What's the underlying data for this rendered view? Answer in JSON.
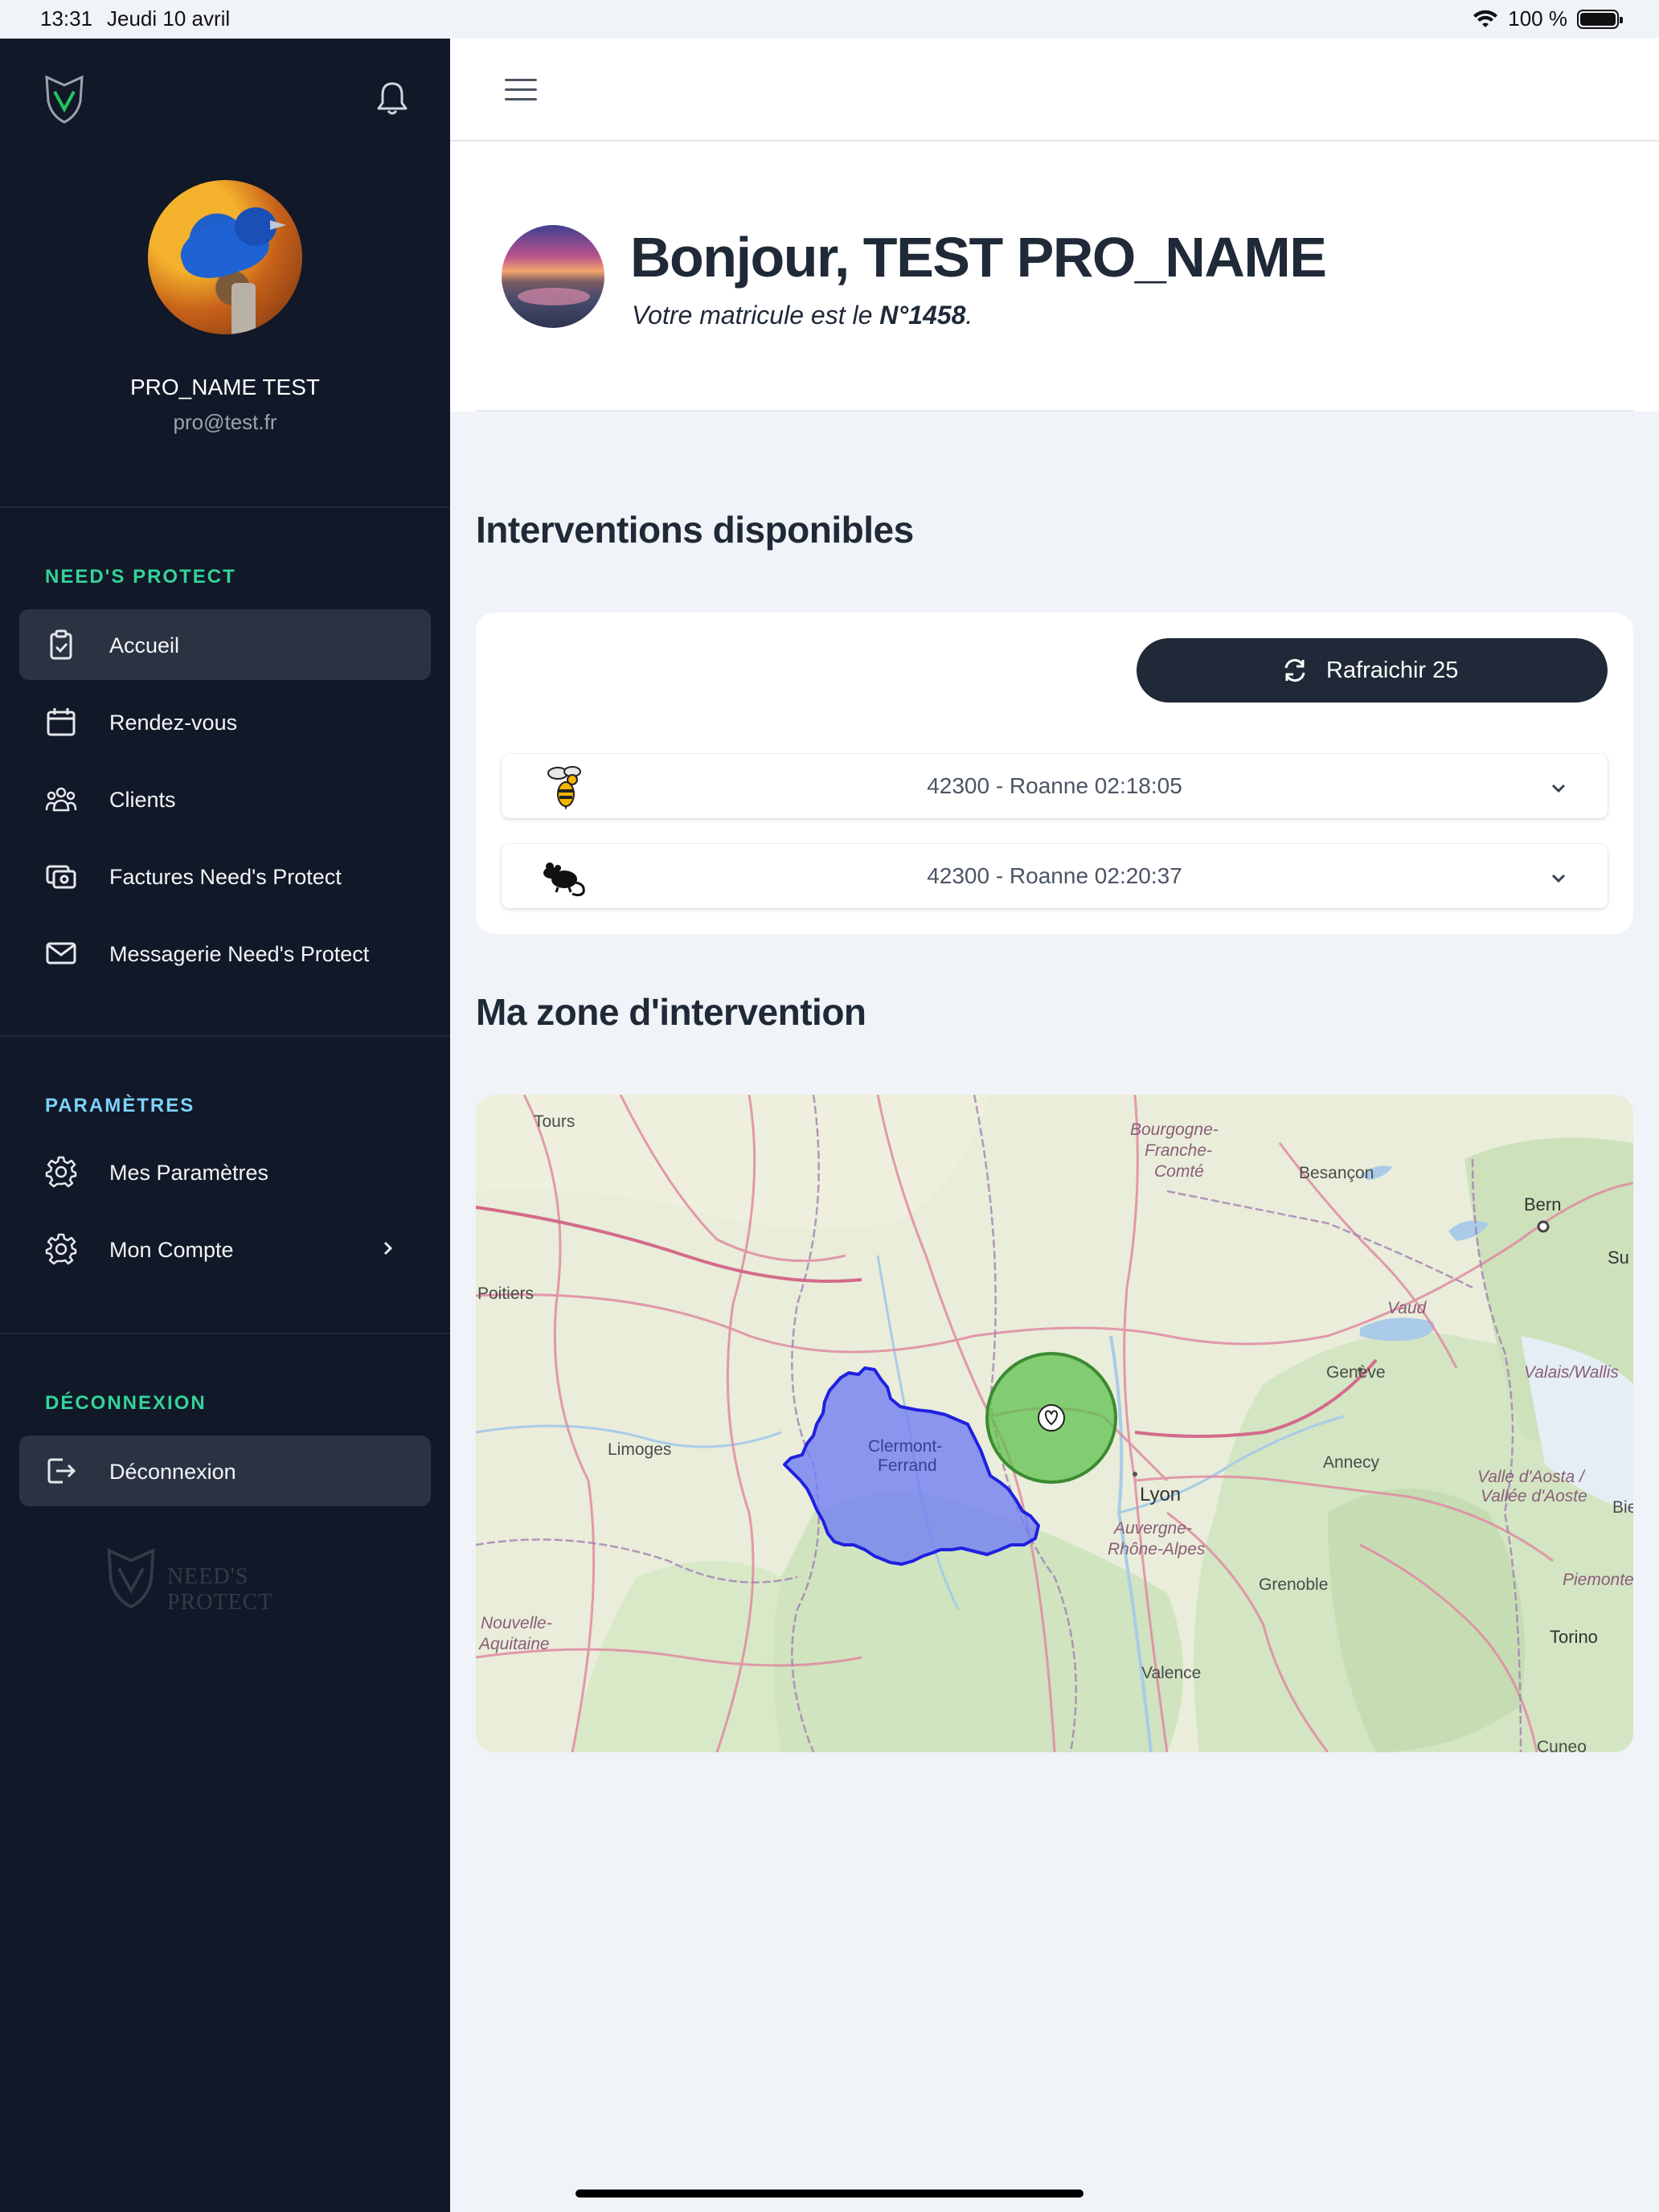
{
  "status_bar": {
    "time": "13:31",
    "date": "Jeudi 10 avril",
    "battery": "100 %"
  },
  "sidebar": {
    "user": {
      "name": "PRO_NAME TEST",
      "email": "pro@test.fr"
    },
    "sections": [
      {
        "title": "NEED'S PROTECT",
        "items": [
          {
            "label": "Accueil",
            "icon": "clipboard-check-icon",
            "active": true
          },
          {
            "label": "Rendez-vous",
            "icon": "calendar-icon"
          },
          {
            "label": "Clients",
            "icon": "users-icon"
          },
          {
            "label": "Factures Need's Protect",
            "icon": "cash-icon"
          },
          {
            "label": "Messagerie Need's Protect",
            "icon": "mail-icon"
          }
        ]
      },
      {
        "title": "PARAMÈTRES",
        "items": [
          {
            "label": "Mes Paramètres",
            "icon": "gear-icon"
          },
          {
            "label": "Mon Compte",
            "icon": "gear-icon",
            "has_chevron": true
          }
        ]
      },
      {
        "title": "DÉCONNEXION",
        "items": [
          {
            "label": "Déconnexion",
            "icon": "logout-icon",
            "active": true
          }
        ]
      }
    ],
    "watermark": "NEED'S PROTECT"
  },
  "main": {
    "greeting": {
      "title": "Bonjour, TEST PRO_NAME",
      "subtitle_prefix": "Votre matricule est le ",
      "matricule": "N°1458",
      "subtitle_suffix": "."
    },
    "interventions": {
      "heading": "Interventions disponibles",
      "refresh_label": "Rafraichir 25",
      "items": [
        {
          "pest": "wasp-icon",
          "text": "42300 - Roanne 02:18:05"
        },
        {
          "pest": "rat-icon",
          "text": "42300 - Roanne 02:20:37"
        }
      ]
    },
    "zone": {
      "heading": "Ma zone d'intervention",
      "map_labels": {
        "tours": "Tours",
        "bourgogne": "Bourgogne-",
        "franche": "Franche-",
        "comte": "Comté",
        "besancon": "Besançon",
        "bern": "Bern",
        "su": "Su",
        "poitiers": "Poitiers",
        "vaud": "Vaud",
        "geneve": "Genève",
        "valais": "Valais/Wallis",
        "limoges": "Limoges",
        "clermont1": "Clermont-",
        "clermont2": "Ferrand",
        "annecy": "Annecy",
        "aoste1": "Valle d'Aosta /",
        "aoste2": "Vallée d'Aoste",
        "bie": "Bie",
        "lyon": "Lyon",
        "auvergne1": "Auvergne-",
        "auvergne2": "Rhône-Alpes",
        "grenoble": "Grenoble",
        "piemonte": "Piemonte",
        "nouvelle1": "Nouvelle-",
        "nouvelle2": "Aquitaine",
        "torino": "Torino",
        "valence": "Valence",
        "cuneo": "Cuneo"
      }
    }
  }
}
